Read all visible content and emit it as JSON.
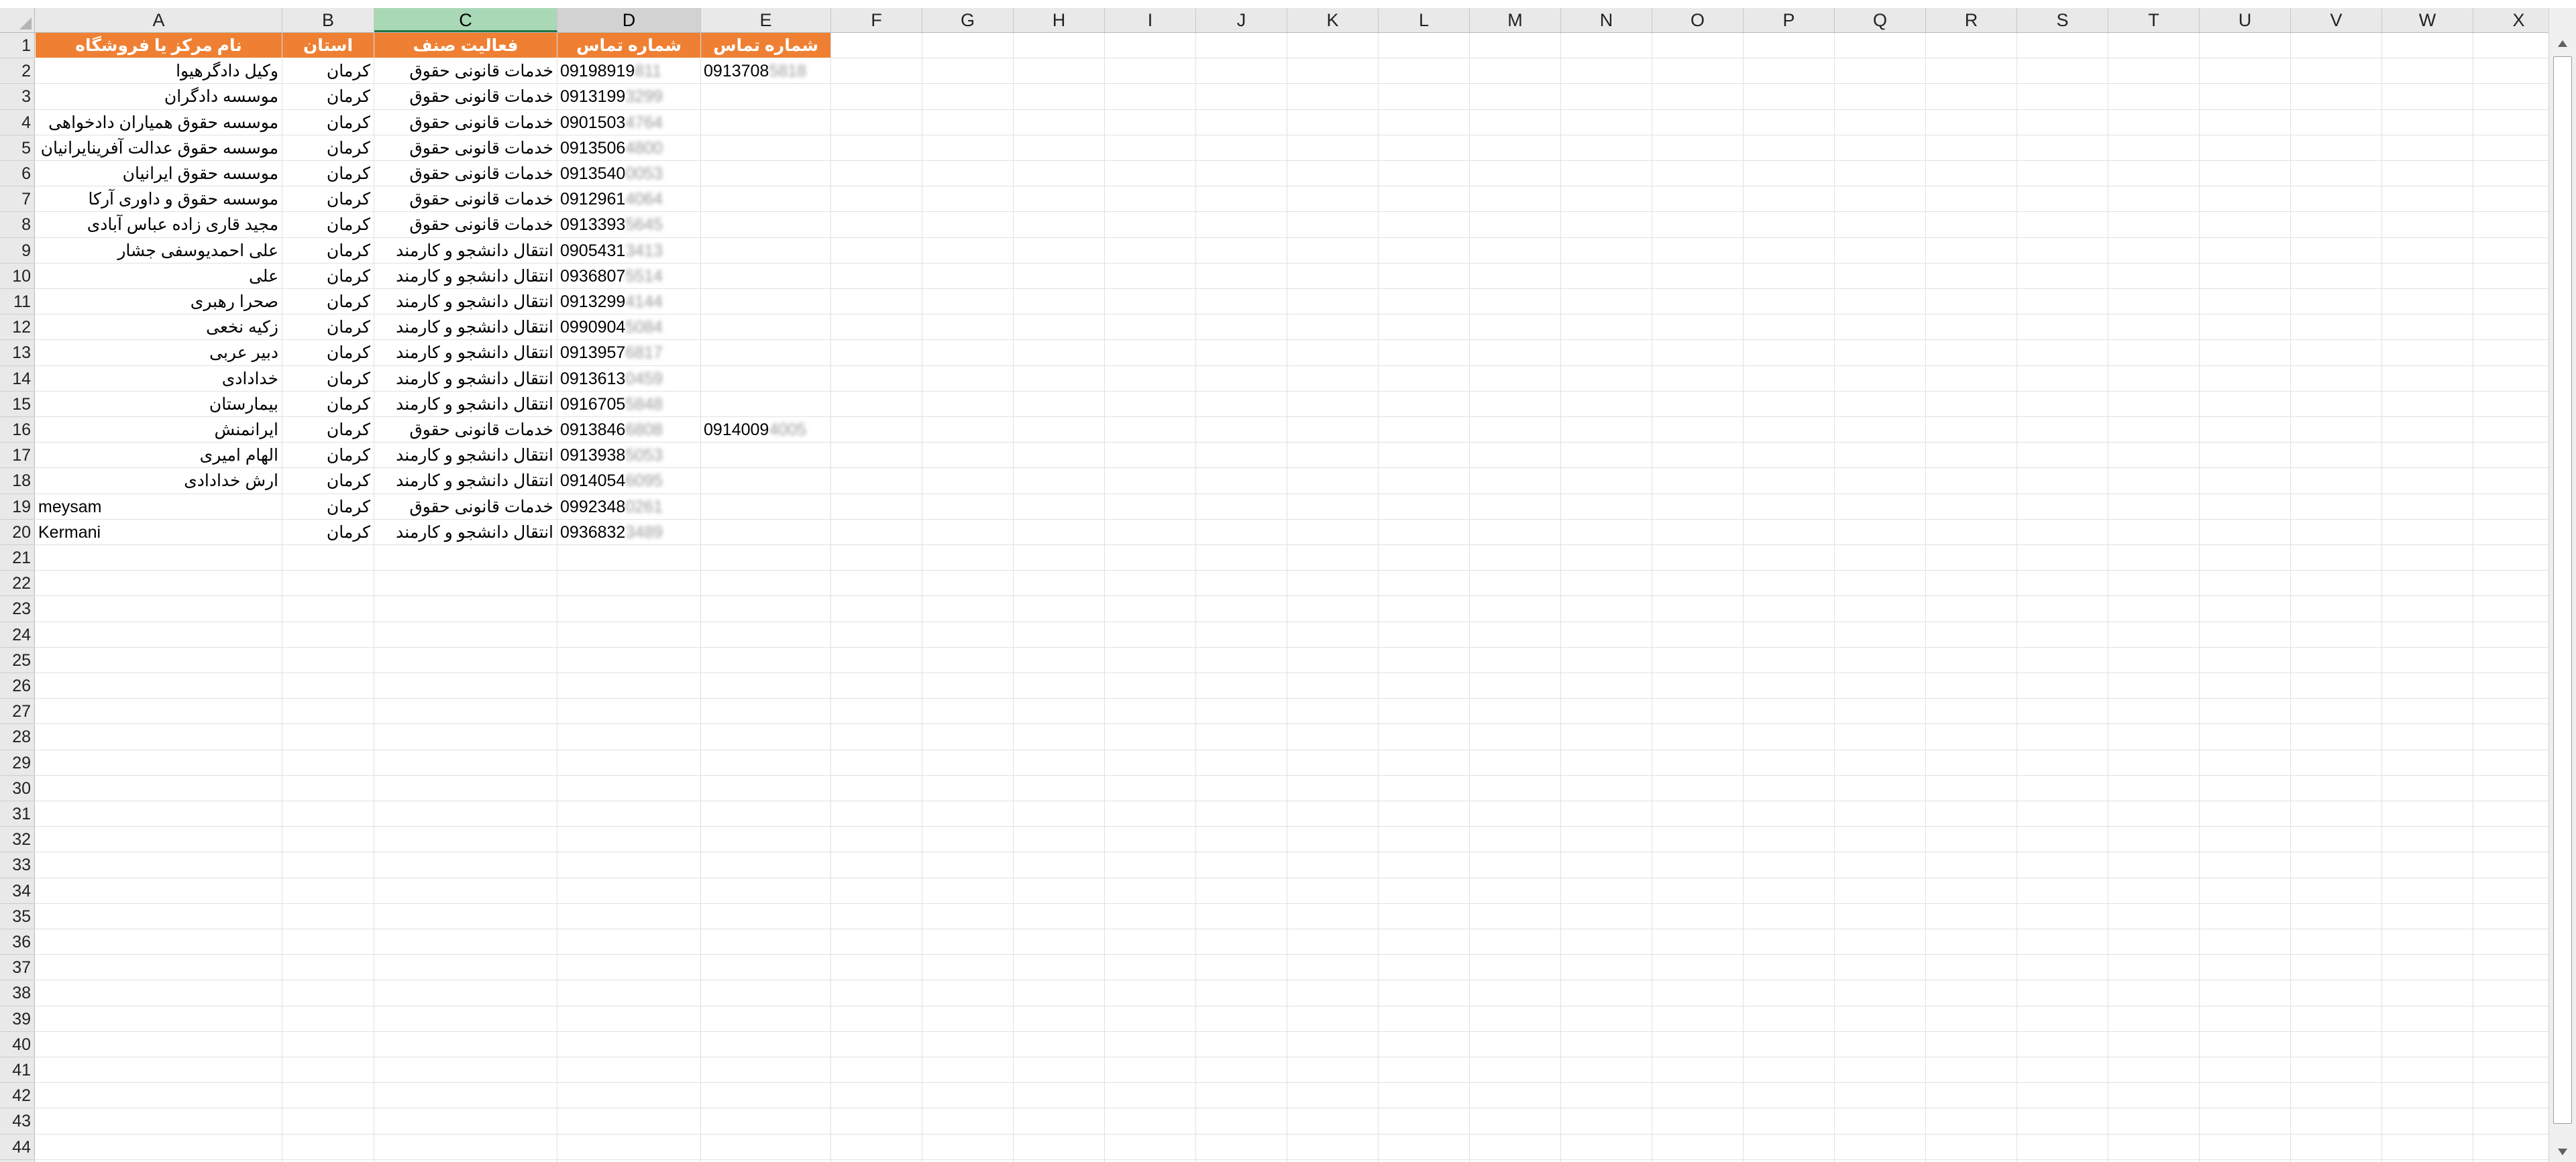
{
  "columns": [
    "A",
    "B",
    "C",
    "D",
    "E",
    "F",
    "G",
    "H",
    "I",
    "J",
    "K",
    "L",
    "M",
    "N",
    "O",
    "P",
    "Q",
    "R",
    "S",
    "T",
    "U",
    "V",
    "W",
    "X"
  ],
  "row_numbers": [
    1,
    2,
    3,
    4,
    5,
    6,
    7,
    8,
    9,
    10,
    11,
    12,
    13,
    14,
    15,
    16,
    17,
    18,
    19,
    20,
    21,
    22,
    23,
    24,
    25,
    26,
    27,
    28,
    29,
    30,
    31,
    32,
    33,
    34,
    35,
    36,
    37,
    38,
    39,
    40,
    41,
    42,
    43,
    44
  ],
  "header_row": {
    "A": "نام مرکز یا فروشگاه",
    "B": "استان",
    "C": "فعالیت صنف",
    "D": "شماره تماس",
    "E": "شماره تماس"
  },
  "rows": [
    {
      "A": "وکیل دادگرهیوا",
      "B": "کرمان",
      "C": "خدمات قانونی حقوق",
      "D": "09198919",
      "D_hidden": "811",
      "E": "0913708",
      "E_hidden": "5818"
    },
    {
      "A": "موسسه دادگران",
      "B": "کرمان",
      "C": "خدمات قانونی حقوق",
      "D": "0913199",
      "D_hidden": "3299",
      "E": "",
      "E_hidden": ""
    },
    {
      "A": "موسسه حقوق همیاران دادخواهی",
      "B": "کرمان",
      "C": "خدمات قانونی حقوق",
      "D": "0901503",
      "D_hidden": "4764",
      "E": "",
      "E_hidden": ""
    },
    {
      "A": "موسسه حقوق عدالت آفرینایرانیان",
      "B": "کرمان",
      "C": "خدمات قانونی حقوق",
      "D": "0913506",
      "D_hidden": "4800",
      "E": "",
      "E_hidden": ""
    },
    {
      "A": "موسسه حقوق ایرانیان",
      "B": "کرمان",
      "C": "خدمات قانونی حقوق",
      "D": "0913540",
      "D_hidden": "0053",
      "E": "",
      "E_hidden": ""
    },
    {
      "A": "موسسه حقوق و داوری آرکا",
      "B": "کرمان",
      "C": "خدمات قانونی حقوق",
      "D": "0912961",
      "D_hidden": "4064",
      "E": "",
      "E_hidden": ""
    },
    {
      "A": "مجید قاری زاده عباس آبادی",
      "B": "کرمان",
      "C": "خدمات قانونی حقوق",
      "D": "0913393",
      "D_hidden": "5645",
      "E": "",
      "E_hidden": ""
    },
    {
      "A": "علی احمدیوسفی جشار",
      "B": "کرمان",
      "C": "انتقال دانشجو و کارمند",
      "D": "0905431",
      "D_hidden": "3413",
      "E": "",
      "E_hidden": ""
    },
    {
      "A": "علی",
      "B": "کرمان",
      "C": "انتقال دانشجو و کارمند",
      "D": "0936807",
      "D_hidden": "5514",
      "E": "",
      "E_hidden": ""
    },
    {
      "A": "صحرا رهبری",
      "B": "کرمان",
      "C": "انتقال دانشجو و کارمند",
      "D": "0913299",
      "D_hidden": "4144",
      "E": "",
      "E_hidden": ""
    },
    {
      "A": "زکیه نخعی",
      "B": "کرمان",
      "C": "انتقال دانشجو و کارمند",
      "D": "0990904",
      "D_hidden": "5084",
      "E": "",
      "E_hidden": ""
    },
    {
      "A": "دبیر عربی",
      "B": "کرمان",
      "C": "انتقال دانشجو و کارمند",
      "D": "0913957",
      "D_hidden": "6817",
      "E": "",
      "E_hidden": ""
    },
    {
      "A": "خدادادی",
      "B": "کرمان",
      "C": "انتقال دانشجو و کارمند",
      "D": "0913613",
      "D_hidden": "0459",
      "E": "",
      "E_hidden": ""
    },
    {
      "A": "بیمارستان",
      "B": "کرمان",
      "C": "انتقال دانشجو و کارمند",
      "D": "0916705",
      "D_hidden": "5848",
      "E": "",
      "E_hidden": ""
    },
    {
      "A": "ایرانمنش",
      "B": "کرمان",
      "C": "خدمات قانونی حقوق",
      "D": "0913846",
      "D_hidden": "6808",
      "E": "0914009",
      "E_hidden": "4005"
    },
    {
      "A": "الهام امیری",
      "B": "کرمان",
      "C": "انتقال دانشجو و کارمند",
      "D": "0913938",
      "D_hidden": "5053",
      "E": "",
      "E_hidden": ""
    },
    {
      "A": "ارش خدادادی",
      "B": "کرمان",
      "C": "انتقال دانشجو و کارمند",
      "D": "0914054",
      "D_hidden": "6095",
      "E": "",
      "E_hidden": ""
    },
    {
      "A": "meysam",
      "B": "کرمان",
      "C": "خدمات قانونی حقوق",
      "D": "0992348",
      "D_hidden": "0261",
      "E": "",
      "E_hidden": ""
    },
    {
      "A": "Kermani",
      "B": "کرمان",
      "C": "انتقال دانشجو و کارمند",
      "D": "0936832",
      "D_hidden": "3489",
      "E": "",
      "E_hidden": ""
    }
  ],
  "colors": {
    "header_fill": "#ef8033",
    "header_text": "#ffffff",
    "selected_col_fill": "#a9d8b7",
    "gridline": "#e1e1e1"
  }
}
